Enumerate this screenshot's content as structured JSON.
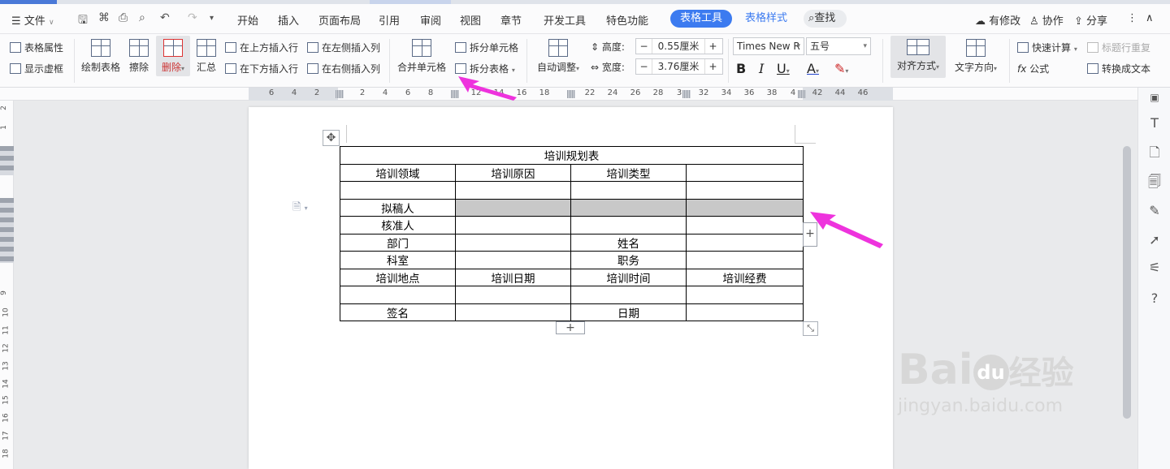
{
  "menubar": {
    "file_label": "文件",
    "tabs": [
      "开始",
      "插入",
      "页面布局",
      "引用",
      "审阅",
      "视图",
      "章节",
      "开发工具",
      "特色功能"
    ],
    "active_tab": "表格工具",
    "style_tab": "表格样式",
    "search_label": "查找",
    "modified_label": "有修改",
    "collab_label": "协作",
    "share_label": "分享"
  },
  "ribbon": {
    "table_props": "表格属性",
    "show_gridlines": "显示虚框",
    "draw_table": "绘制表格",
    "erase": "擦除",
    "delete": "删除",
    "summary": "汇总",
    "insert_row_above": "在上方插入行",
    "insert_row_below": "在下方插入行",
    "insert_col_left": "在左侧插入列",
    "insert_col_right": "在右侧插入列",
    "merge_cells": "合并单元格",
    "split_cells": "拆分单元格",
    "split_table": "拆分表格",
    "auto_adjust": "自动调整",
    "height_label": "高度:",
    "height_value": "0.55厘米",
    "width_label": "宽度:",
    "width_value": "3.76厘米",
    "font_name": "Times New R",
    "font_size": "五号",
    "align": "对齐方式",
    "text_direction": "文字方向",
    "quick_calc": "快速计算",
    "repeat_header": "标题行重复",
    "formula": "公式",
    "to_text": "转换成文本",
    "minus": "−",
    "plus": "+"
  },
  "ruler": {
    "ticks": [
      "6",
      "4",
      "2",
      "2",
      "4",
      "6",
      "8",
      "12",
      "14",
      "16",
      "18",
      "22",
      "24",
      "26",
      "28",
      "3",
      "32",
      "34",
      "36",
      "38",
      "4",
      "42",
      "44",
      "46"
    ]
  },
  "vruler": {
    "ticks": [
      "2",
      "1",
      "1",
      "2",
      "9",
      "10",
      "11",
      "12",
      "13",
      "14",
      "15",
      "16",
      "17",
      "18",
      "19"
    ]
  },
  "table": {
    "title": "培训规划表",
    "r1": [
      "培训领域",
      "培训原因",
      "培训类型",
      ""
    ],
    "r3": [
      "拟稿人"
    ],
    "r4": [
      "核准人"
    ],
    "r5": [
      "部门",
      "",
      "姓名",
      ""
    ],
    "r6": [
      "科室",
      "",
      "职务",
      ""
    ],
    "r7": [
      "培训地点",
      "培训日期",
      "培训时间",
      "培训经费"
    ],
    "r9": [
      "签名",
      "",
      "日期",
      ""
    ]
  },
  "watermark": {
    "line1": "Bai",
    "line1b": "du",
    "line1c": "经验",
    "line2": "jingyan.baidu.com"
  },
  "colors": {
    "accent": "#3c7bf0",
    "arrow": "#ee33dd",
    "highlight": "#c8c8c8"
  }
}
